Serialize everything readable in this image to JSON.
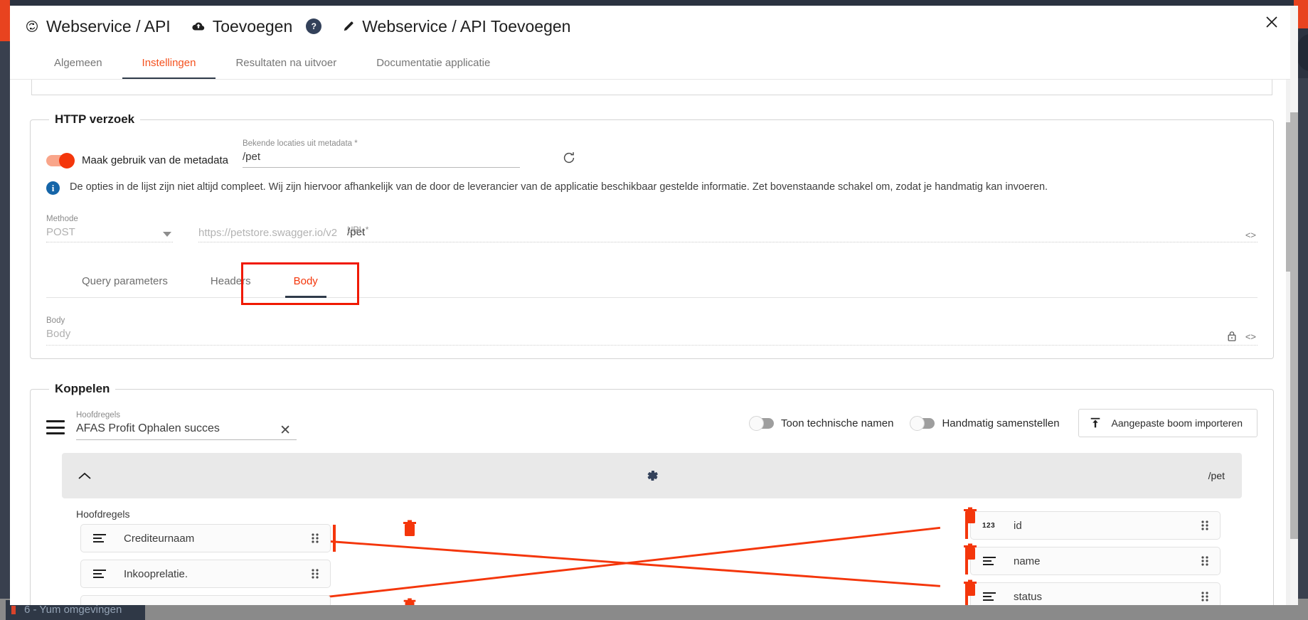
{
  "breadcrumb": [
    {
      "icon": "cloud-sync-icon",
      "label": "Webservice / API"
    },
    {
      "icon": "cloud-upload-icon",
      "label": "Toevoegen",
      "help": "?"
    },
    {
      "icon": "pencil-icon",
      "label": "Webservice / API Toevoegen"
    }
  ],
  "close_icon": "✕",
  "tabs": [
    {
      "label": "Algemeen",
      "active": false
    },
    {
      "label": "Instellingen",
      "active": true
    },
    {
      "label": "Resultaten na uitvoer",
      "active": false
    },
    {
      "label": "Documentatie applicatie",
      "active": false
    }
  ],
  "http_request": {
    "legend": "HTTP verzoek",
    "metadata_toggle_label": "Maak gebruik van de metadata",
    "metadata_toggle_on": true,
    "metadata_field": {
      "label": "Bekende locaties uit metadata *",
      "value": "/pet"
    },
    "refresh_icon": "refresh-icon",
    "info_icon": "info-icon",
    "info_text": "De opties in de lijst zijn niet altijd compleet. Wij zijn hiervoor afhankelijk van de door de leverancier van de applicatie beschikbaar gestelde informatie. Zet bovenstaande schakel om, zodat je handmatig kan invoeren.",
    "method": {
      "label": "Methode",
      "value": "POST"
    },
    "url": {
      "label": "URL *",
      "base": "https://petstore.swagger.io/v2",
      "value": "/pet",
      "code_icon": "<>"
    },
    "inner_tabs": [
      {
        "label": "Query parameters",
        "active": false
      },
      {
        "label": "Headers",
        "active": false
      },
      {
        "label": "Body",
        "active": true,
        "highlighted": true
      }
    ],
    "body_field": {
      "label": "Body",
      "placeholder": "Body",
      "lock_icon": "lock-icon",
      "code_icon": "<>"
    }
  },
  "koppelen": {
    "legend": "Koppelen",
    "menu_icon": "hamburger-icon",
    "source": {
      "label": "Hoofdregels",
      "value": "AFAS Profit Ophalen succes",
      "clear_icon": "✕"
    },
    "toggles": [
      {
        "label": "Toon technische namen",
        "on": false
      },
      {
        "label": "Handmatig samenstellen",
        "on": false
      }
    ],
    "import_button": {
      "label": "Aangepaste boom importeren",
      "icon": "upload-icon"
    },
    "tree_header": {
      "collapse_icon": "chevron-up-icon",
      "settings_icon": "gear-icon",
      "path": "/pet"
    },
    "mapping": {
      "left_group_label": "Hoofdregels",
      "left_nodes": [
        {
          "icon": "text-field-icon",
          "label": "Crediteurnaam",
          "grip": "drag-handle-icon"
        },
        {
          "icon": "text-field-icon",
          "label": "Inkooprelatie.",
          "grip": "drag-handle-icon"
        },
        {
          "icon": "text-field-icon",
          "label": "",
          "grip": "drag-handle-icon"
        }
      ],
      "right_nodes": [
        {
          "icon": "number-field-icon",
          "icon_text": "123",
          "label": "id",
          "grip": "drag-handle-icon"
        },
        {
          "icon": "text-field-icon",
          "label": "name",
          "grip": "drag-handle-icon"
        },
        {
          "icon": "text-field-icon",
          "label": "status",
          "grip": "drag-handle-icon"
        }
      ]
    }
  },
  "taskbar": {
    "app_label": "6 - Yum omgevingen"
  },
  "colors": {
    "accent": "#f4360b",
    "tab_active": "#f4511e",
    "underline": "#2f3b4a",
    "info_blue": "#1565a8",
    "highlight_border": "#f01900"
  }
}
